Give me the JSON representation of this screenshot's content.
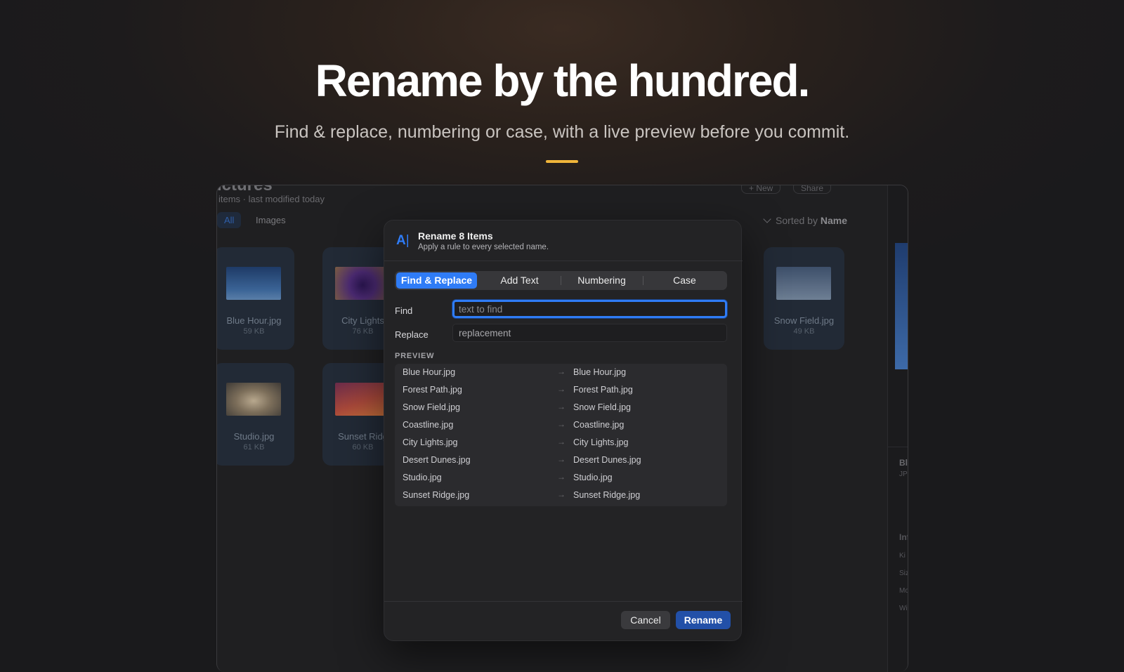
{
  "hero": {
    "title": "Rename by the hundred.",
    "subtitle": "Find & replace, numbering or case, with a live preview before you commit.",
    "accent_color": "#f0b53a"
  },
  "window": {
    "folder_title": "ictures",
    "folder_subtitle": "items · last modified today",
    "filters": [
      "All",
      "Images"
    ],
    "toolbar": {
      "new_label": "+ New",
      "share_label": "Share"
    },
    "sort": {
      "prefix": "Sorted by",
      "value": "Name"
    },
    "tiles": [
      {
        "name": "Blue Hour.jpg",
        "size": "59 KB"
      },
      {
        "name": "City Lights",
        "size": "76 KB"
      },
      {
        "name": "Snow Field.jpg",
        "size": "49 KB"
      },
      {
        "name": "Studio.jpg",
        "size": "61 KB"
      },
      {
        "name": "Sunset Ridg",
        "size": "60 KB"
      }
    ],
    "side_panel": {
      "title": "Bl",
      "type": "JP",
      "section": "Inf",
      "keys": [
        "Ki",
        "Siz",
        "Mo",
        "Wi"
      ]
    }
  },
  "dialog": {
    "icon": "rename-text-icon",
    "title": "Rename 8 Items",
    "subtitle": "Apply a rule to every selected name.",
    "tabs": [
      "Find & Replace",
      "Add Text",
      "Numbering",
      "Case"
    ],
    "active_tab": "Find & Replace",
    "find": {
      "label": "Find",
      "placeholder": "text to find",
      "value": ""
    },
    "replace": {
      "label": "Replace",
      "placeholder": "replacement",
      "value": ""
    },
    "preview_label": "PREVIEW",
    "preview": [
      {
        "old": "Blue Hour.jpg",
        "new": "Blue Hour.jpg"
      },
      {
        "old": "Forest Path.jpg",
        "new": "Forest Path.jpg"
      },
      {
        "old": "Snow Field.jpg",
        "new": "Snow Field.jpg"
      },
      {
        "old": "Coastline.jpg",
        "new": "Coastline.jpg"
      },
      {
        "old": "City Lights.jpg",
        "new": "City Lights.jpg"
      },
      {
        "old": "Desert Dunes.jpg",
        "new": "Desert Dunes.jpg"
      },
      {
        "old": "Studio.jpg",
        "new": "Studio.jpg"
      },
      {
        "old": "Sunset Ridge.jpg",
        "new": "Sunset Ridge.jpg"
      }
    ],
    "cancel_label": "Cancel",
    "rename_label": "Rename",
    "accent_color": "#2f7cf6"
  }
}
